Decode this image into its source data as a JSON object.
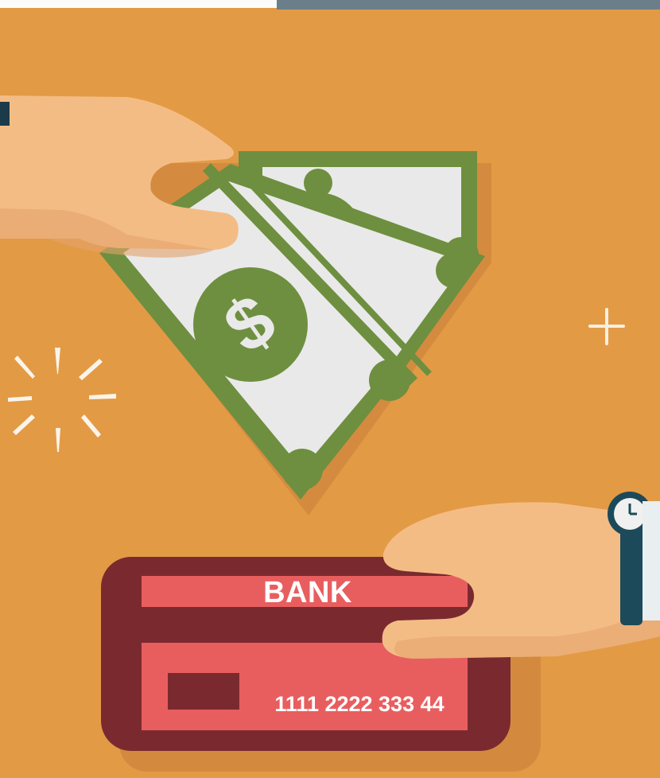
{
  "illustration": {
    "card": {
      "bank_label": "BANK",
      "card_number": "1111 2222 333 44"
    },
    "colors": {
      "background": "#e39a45",
      "bill_green": "#6e8f3f",
      "bill_face": "#e9e9e9",
      "card_dark": "#7a2a2f",
      "card_light": "#e85e5f",
      "skin": "#f4bc85",
      "watch_strap": "#1c4a5a"
    },
    "icons": [
      "plus-sparkle-icon",
      "burst-rays-icon",
      "dollar-sign-icon",
      "wristwatch-icon"
    ]
  }
}
